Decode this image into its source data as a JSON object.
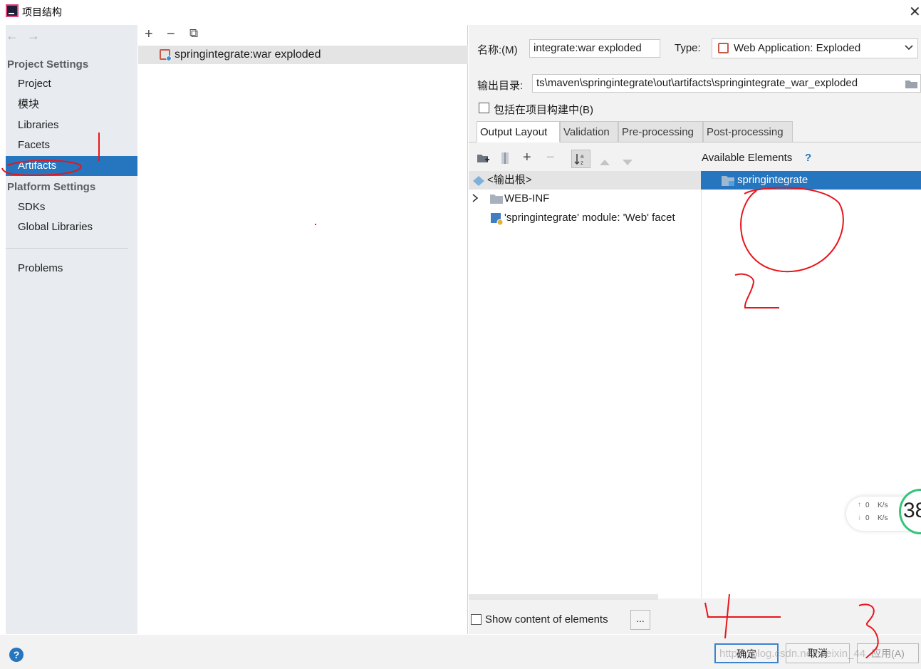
{
  "window": {
    "title": "项目结构",
    "close_glyph": "✕"
  },
  "nav": {
    "back_glyph": "←",
    "forward_glyph": "→",
    "project_settings": "Project Settings",
    "items_project": [
      "Project",
      "模块",
      "Libraries",
      "Facets",
      "Artifacts"
    ],
    "platform_settings": "Platform Settings",
    "items_platform": [
      "SDKs",
      "Global Libraries"
    ],
    "problems": "Problems",
    "selected": "Artifacts"
  },
  "list": {
    "toolbar": {
      "add": "+",
      "remove": "−",
      "copy": "⧉"
    },
    "artifact": "springintegrate:war exploded"
  },
  "detail": {
    "name_label": "名称:(M)",
    "name_value": "integrate:war exploded",
    "type_label": "Type:",
    "type_value": "Web Application: Exploded",
    "output_label": "输出目录:",
    "output_value": "ts\\maven\\springintegrate\\out\\artifacts\\springintegrate_war_exploded",
    "include_label": "包括在项目构建中(B)",
    "tabs": [
      "Output Layout",
      "Validation",
      "Pre-processing",
      "Post-processing"
    ],
    "active_tab": "Output Layout",
    "available_label": "Available Elements",
    "available_help": "?",
    "tree": {
      "root": "<输出根>",
      "webinf": "WEB-INF",
      "facet": "'springintegrate' module: 'Web' facet"
    },
    "available_item": "springintegrate",
    "show_content_label": "Show content of elements",
    "ellipsis": "..."
  },
  "footer": {
    "help": "?",
    "ok": "确定",
    "cancel": "取消",
    "apply": "应用(A)"
  },
  "speed": {
    "up_value": "0",
    "down_value": "0",
    "unit": "K/s",
    "gauge": "38"
  },
  "watermark": "https://blog.csdn.net/weixin_44",
  "annotations": {
    "mark1": "1",
    "mark2": "2",
    "mark3": "3",
    "mark4": "4"
  },
  "colors": {
    "selection": "#2675bf",
    "nav_bg": "#e8ecf1",
    "pane_bg": "#f2f2f2",
    "annotation": "#e8151b"
  }
}
